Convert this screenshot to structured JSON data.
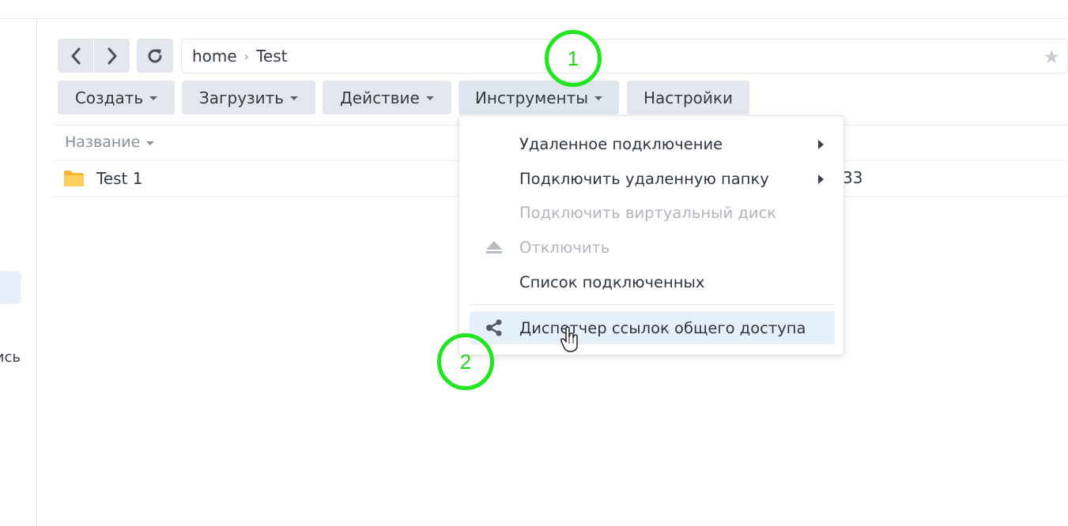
{
  "breadcrumb": {
    "items": [
      "home",
      "Test"
    ]
  },
  "toolbar": {
    "create_label": "Создать",
    "upload_label": "Загрузить",
    "action_label": "Действие",
    "tools_label": "Инструменты",
    "settings_label": "Настройки"
  },
  "sidebar": {
    "partial_label": "ись"
  },
  "list": {
    "column_name": "Название",
    "rows": [
      {
        "name": "Test 1",
        "extra": "33"
      }
    ]
  },
  "menu": {
    "items": [
      {
        "label": "Удаленное подключение",
        "submenu": true,
        "disabled": false
      },
      {
        "label": "Подключить удаленную папку",
        "submenu": true,
        "disabled": false
      },
      {
        "label": "Подключить виртуальный диск",
        "submenu": false,
        "disabled": true
      },
      {
        "label": "Отключить",
        "icon": "eject-icon",
        "submenu": false,
        "disabled": true
      },
      {
        "label": "Список подключенных",
        "submenu": false,
        "disabled": false
      },
      {
        "label": "Диспетчер ссылок общего доступа",
        "icon": "share-icon",
        "submenu": false,
        "disabled": false,
        "hovered": true
      }
    ]
  },
  "annotations": {
    "first": "1",
    "second": "2"
  },
  "colors": {
    "annotation": "#1fe61f",
    "hover_bg": "#e5f0fb",
    "folder": "#ffc94d",
    "button_bg": "#e4e8ee"
  }
}
